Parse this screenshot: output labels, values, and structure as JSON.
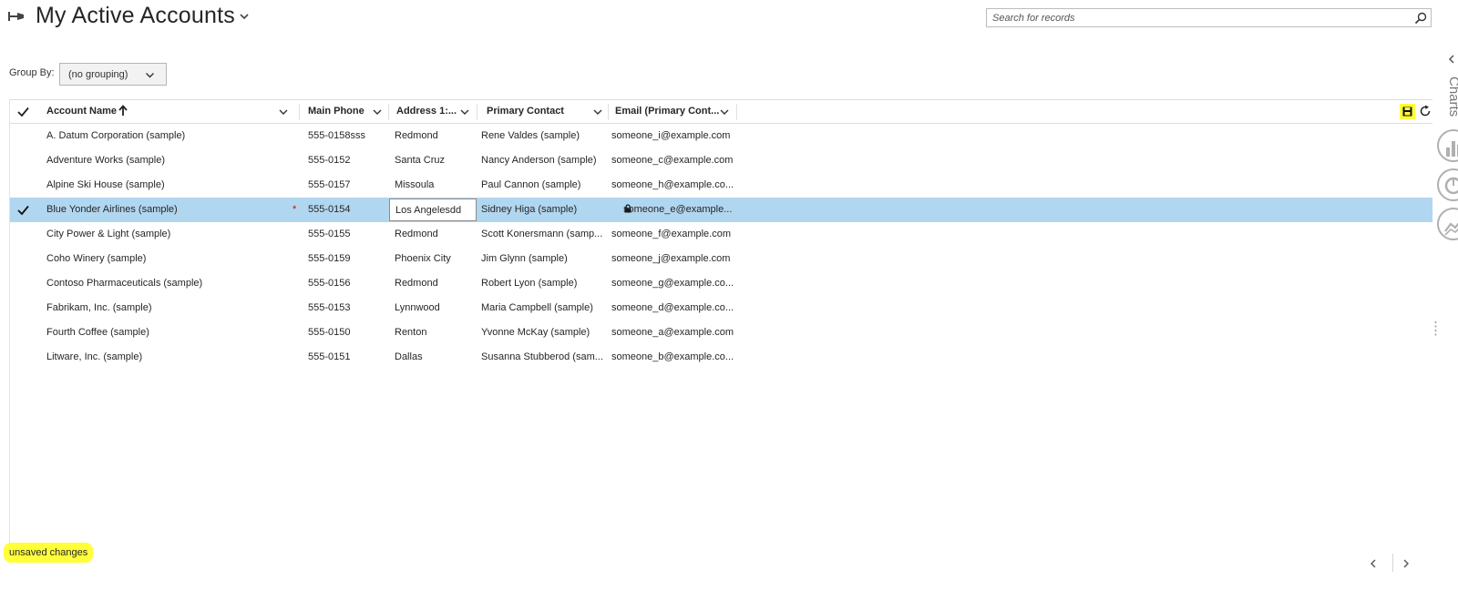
{
  "header": {
    "title": "My Active Accounts",
    "search_placeholder": "Search for records"
  },
  "group_by": {
    "label": "Group By:",
    "value": "(no grouping)"
  },
  "columns": [
    {
      "label": "Account Name",
      "sorted": "ascending"
    },
    {
      "label": "Main Phone"
    },
    {
      "label": "Address 1:..."
    },
    {
      "label": "Primary Contact"
    },
    {
      "label": "Email (Primary Cont..."
    }
  ],
  "rows": [
    {
      "account": "A. Datum Corporation (sample)",
      "phone": "555-0158sss",
      "city": "Redmond",
      "contact": "Rene Valdes (sample)",
      "email": "someone_i@example.com",
      "selected": false
    },
    {
      "account": "Adventure Works (sample)",
      "phone": "555-0152",
      "city": "Santa Cruz",
      "contact": "Nancy Anderson (sample)",
      "email": "someone_c@example.com",
      "selected": false
    },
    {
      "account": "Alpine Ski House (sample)",
      "phone": "555-0157",
      "city": "Missoula",
      "contact": "Paul Cannon (sample)",
      "email": "someone_h@example.co...",
      "selected": false
    },
    {
      "account": "Blue Yonder Airlines (sample)",
      "phone": "555-0154",
      "city": "Los Angelesdd",
      "contact": "Sidney Higa (sample)",
      "email": "someone_e@example...",
      "selected": true,
      "dirty_marker": "*"
    },
    {
      "account": "City Power & Light (sample)",
      "phone": "555-0155",
      "city": "Redmond",
      "contact": "Scott Konersmann (samp...",
      "email": "someone_f@example.com",
      "selected": false
    },
    {
      "account": "Coho Winery (sample)",
      "phone": "555-0159",
      "city": "Phoenix City",
      "contact": "Jim Glynn (sample)",
      "email": "someone_j@example.com",
      "selected": false
    },
    {
      "account": "Contoso Pharmaceuticals (sample)",
      "phone": "555-0156",
      "city": "Redmond",
      "contact": "Robert Lyon (sample)",
      "email": "someone_g@example.co...",
      "selected": false
    },
    {
      "account": "Fabrikam, Inc. (sample)",
      "phone": "555-0153",
      "city": "Lynnwood",
      "contact": "Maria Campbell (sample)",
      "email": "someone_d@example.co...",
      "selected": false
    },
    {
      "account": "Fourth Coffee (sample)",
      "phone": "555-0150",
      "city": "Renton",
      "contact": "Yvonne McKay (sample)",
      "email": "someone_a@example.com",
      "selected": false
    },
    {
      "account": "Litware, Inc. (sample)",
      "phone": "555-0151",
      "city": "Dallas",
      "contact": "Susanna Stubberod (sam...",
      "email": "someone_b@example.co...",
      "selected": false
    }
  ],
  "footer": {
    "status": "unsaved changes"
  },
  "charts_pane": {
    "label": "Charts"
  },
  "colors": {
    "selected_row": "#b1d6f0",
    "highlight": "#ffff3a",
    "dirty_marker": "#e00000"
  }
}
